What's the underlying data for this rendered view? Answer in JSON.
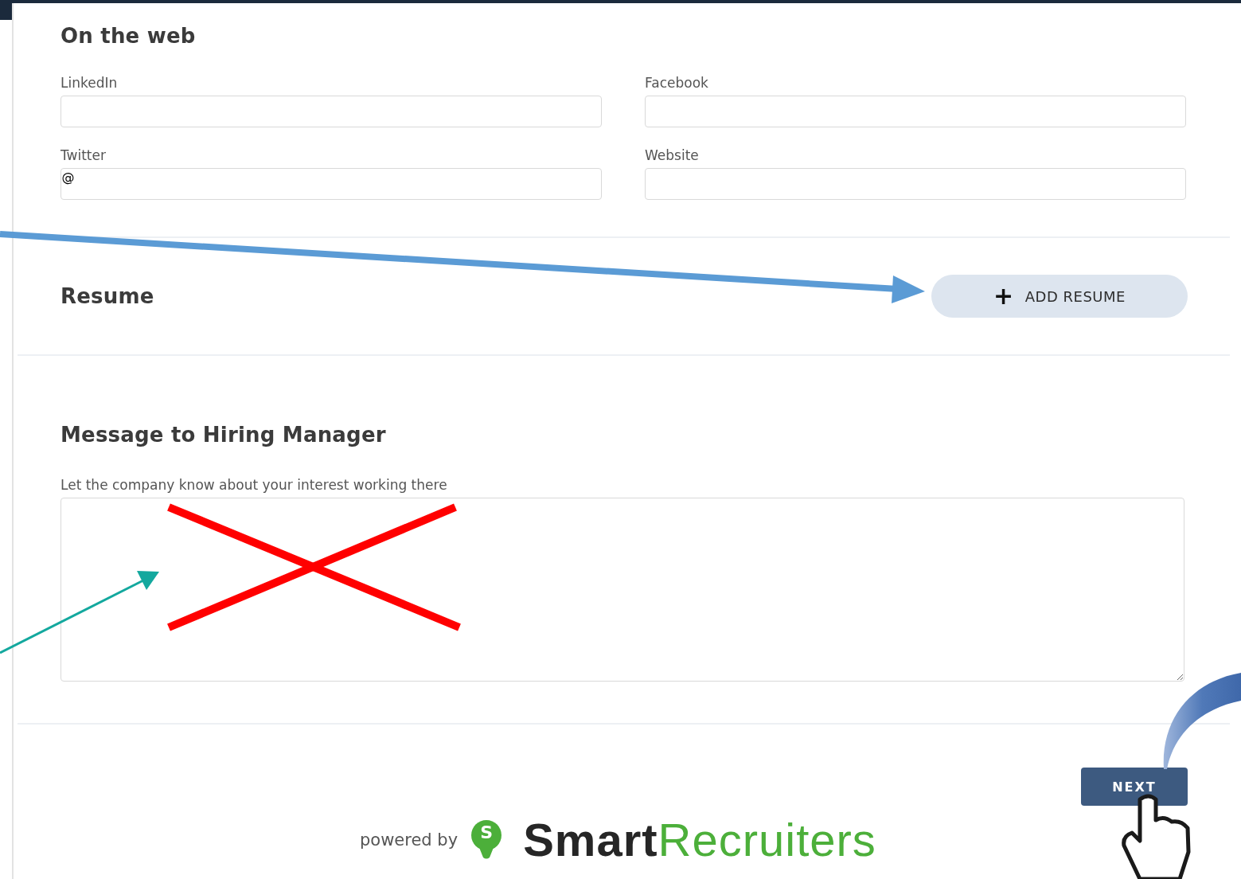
{
  "on_the_web": {
    "title": "On the web",
    "fields": [
      {
        "label": "LinkedIn",
        "kind": "plain"
      },
      {
        "label": "Facebook",
        "kind": "plain"
      },
      {
        "label": "Twitter",
        "kind": "prefixed",
        "prefix": "@"
      },
      {
        "label": "Website",
        "kind": "plain"
      }
    ]
  },
  "resume": {
    "title": "Resume",
    "button": {
      "icon": "+",
      "label": "ADD RESUME"
    }
  },
  "message": {
    "title": "Message to Hiring Manager",
    "hint": "Let the company know about your interest working there"
  },
  "next_button": "NEXT",
  "footer": {
    "powered_by": "powered by",
    "logo_letter": "S",
    "logo_words": [
      "Smart",
      "Recruiters"
    ]
  }
}
